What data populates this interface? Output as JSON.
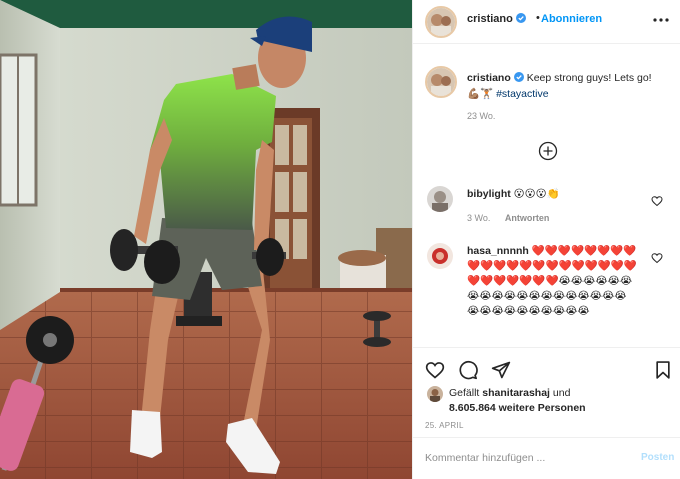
{
  "post": {
    "author": "cristiano",
    "follow_label": "Abonnieren",
    "separator": "•",
    "more_icon": "more-horizontal-icon"
  },
  "caption": {
    "author": "cristiano",
    "text": "Keep strong guys! Lets go! 💪🏽🏋🏽",
    "hashtag": "#stayactive",
    "age": "23 Wo."
  },
  "load_more_icon": "plus-circle-icon",
  "comments": [
    {
      "author": "bibylight",
      "text": "😮😮😮👏",
      "age": "3 Wo.",
      "reply_label": "Antworten"
    },
    {
      "author": "hasa_nnnnh",
      "text": "❤️❤️❤️❤️❤️❤️❤️❤️❤️❤️❤️❤️❤️❤️❤️❤️❤️❤️❤️❤️❤️❤️❤️❤️❤️❤️❤️❤️😭😭😭😭😭😭😭😭😭😭😭😭😭😭😭😭😭😭😭😭😭😭😭😭😭😭😭😭😭"
    }
  ],
  "actions": {
    "like_icon": "heart-icon",
    "comment_icon": "comment-icon",
    "share_icon": "paper-plane-icon",
    "save_icon": "bookmark-icon"
  },
  "likes": {
    "prefix": "Gefällt",
    "user": "shanitarashaj",
    "connector": "und",
    "count": "8.605.864 weitere Personen"
  },
  "date": "25. APRIL",
  "composer": {
    "placeholder": "Kommentar hinzufügen ...",
    "post_label": "Posten"
  },
  "colors": {
    "link_blue": "#0095f6",
    "post_disabled": "#b2dffc",
    "secondary_text": "#8e8e8e",
    "border": "#efefef"
  }
}
